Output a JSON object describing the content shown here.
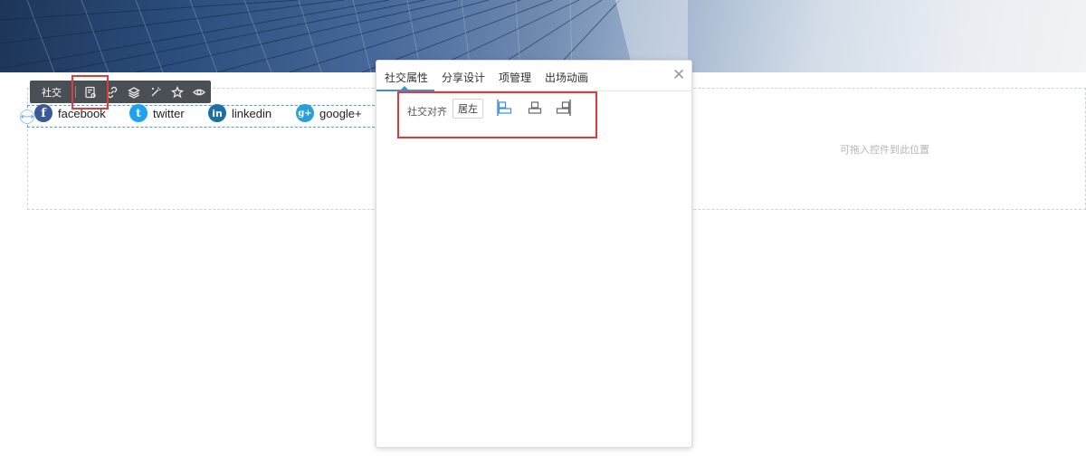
{
  "toolbar": {
    "label": "社交",
    "icons": [
      "settings-doc-icon",
      "link-icon",
      "layers-icon",
      "magic-wand-icon",
      "star-icon",
      "eye-icon"
    ]
  },
  "social": {
    "items": [
      {
        "label": "facebook",
        "icon": "facebook-icon",
        "glyph": "f",
        "color": "#3b5998"
      },
      {
        "label": "twitter",
        "icon": "twitter-icon",
        "glyph": "t",
        "color": "#1da1f2"
      },
      {
        "label": "linkedin",
        "icon": "linkedin-icon",
        "glyph": "in",
        "color": "#1c6fa8"
      },
      {
        "label": "google+",
        "icon": "google-plus-icon",
        "glyph": "g+",
        "color": "#2a9fd8"
      }
    ]
  },
  "dropzone": {
    "hint": "可拖入控件到此位置"
  },
  "panel": {
    "tabs": [
      "社交属性",
      "分享设计",
      "项管理",
      "出场动画"
    ],
    "active_tab": "社交属性",
    "close_glyph": "✕",
    "align_label": "社交对齐",
    "align_value": "居左",
    "align_options": [
      "align-left-icon",
      "align-center-icon",
      "align-right-icon"
    ]
  },
  "colors": {
    "accent": "#3d8fd9",
    "highlight": "#e03a3a",
    "toolbar_bg": "#4a4f55"
  }
}
